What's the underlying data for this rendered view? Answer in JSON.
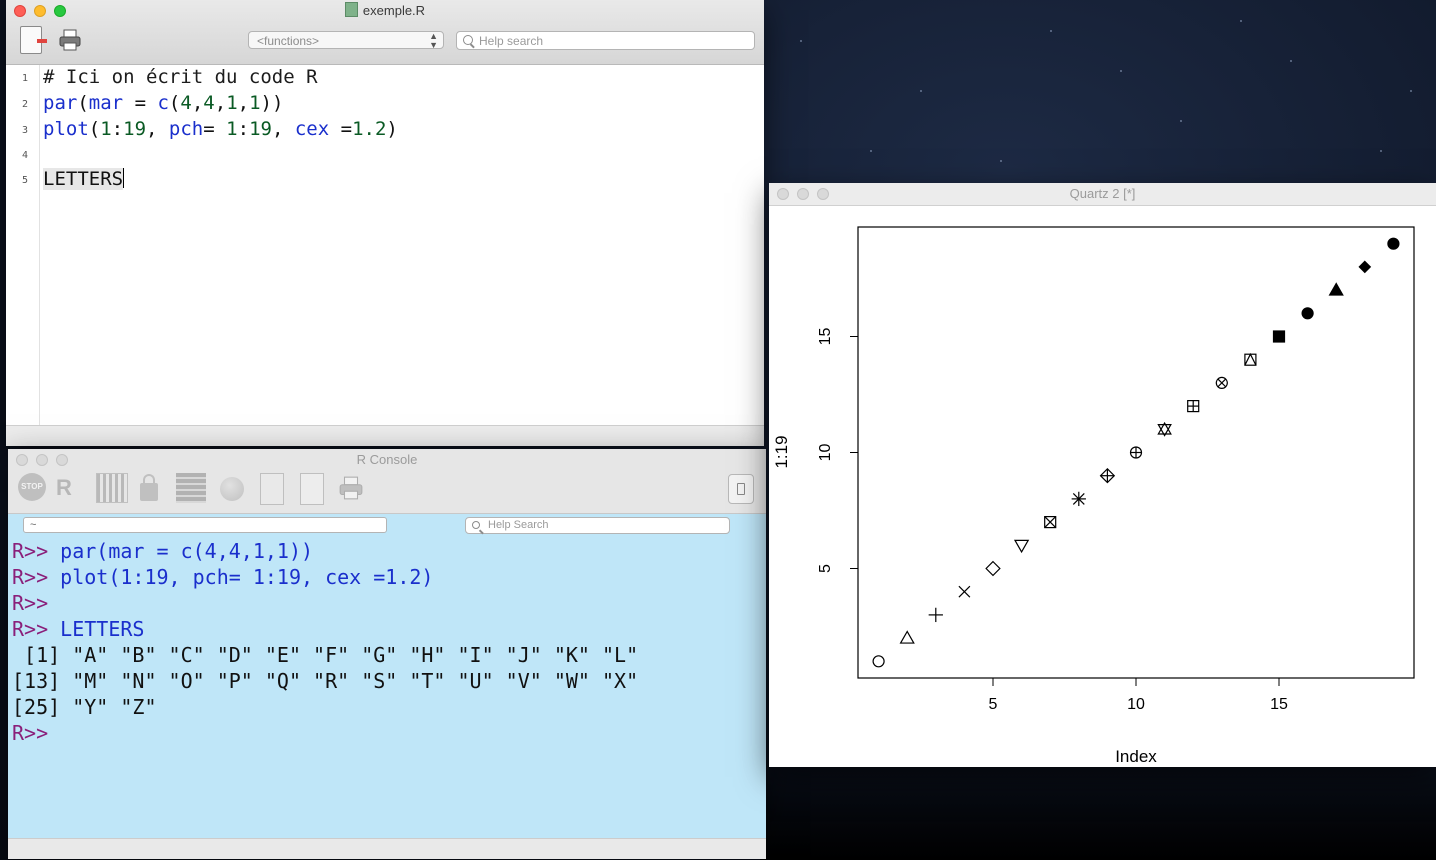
{
  "editor": {
    "title": "exemple.R",
    "functions_select": "<functions>",
    "help_search_placeholder": "Help search",
    "lines": [
      {
        "num": "1",
        "text": "# Ici on écrit du code R"
      },
      {
        "num": "2",
        "text": "par(mar = c(4,4,1,1))"
      },
      {
        "num": "3",
        "text": "plot(1:19, pch= 1:19, cex =1.2)"
      },
      {
        "num": "4",
        "text": ""
      },
      {
        "num": "5",
        "text": "LETTERS"
      }
    ]
  },
  "console": {
    "title": "R Console",
    "stop_label": "STOP",
    "r_label": "R",
    "dir_value": "~",
    "help_search_placeholder": "Help Search",
    "lines": [
      {
        "prompt": "R>>",
        "text": " par(mar = c(4,4,1,1))"
      },
      {
        "prompt": "R>>",
        "text": " plot(1:19, pch= 1:19, cex =1.2)"
      },
      {
        "prompt": "R>>",
        "text": ""
      },
      {
        "prompt": "R>>",
        "text": " LETTERS"
      },
      {
        "prompt": "",
        "text": " [1] \"A\" \"B\" \"C\" \"D\" \"E\" \"F\" \"G\" \"H\" \"I\" \"J\" \"K\" \"L\""
      },
      {
        "prompt": "",
        "text": "[13] \"M\" \"N\" \"O\" \"P\" \"Q\" \"R\" \"S\" \"T\" \"U\" \"V\" \"W\" \"X\""
      },
      {
        "prompt": "",
        "text": "[25] \"Y\" \"Z\""
      },
      {
        "prompt": "R>>",
        "text": ""
      }
    ],
    "colors": {
      "prompt": "#8a1f7a",
      "command": "#1a2fcc",
      "background": "#bfe6f8"
    }
  },
  "quartz": {
    "title": "Quartz 2 [*]"
  },
  "chart_data": {
    "type": "scatter",
    "x": [
      1,
      2,
      3,
      4,
      5,
      6,
      7,
      8,
      9,
      10,
      11,
      12,
      13,
      14,
      15,
      16,
      17,
      18,
      19
    ],
    "y": [
      1,
      2,
      3,
      4,
      5,
      6,
      7,
      8,
      9,
      10,
      11,
      12,
      13,
      14,
      15,
      16,
      17,
      18,
      19
    ],
    "pch": [
      1,
      2,
      3,
      4,
      5,
      6,
      7,
      8,
      9,
      10,
      11,
      12,
      13,
      14,
      15,
      16,
      17,
      18,
      19
    ],
    "xlabel": "Index",
    "ylabel": "1:19",
    "xticks": [
      5,
      10,
      15
    ],
    "yticks": [
      5,
      10,
      15
    ],
    "xlim": [
      0.28,
      19.72
    ],
    "ylim": [
      0.28,
      19.72
    ],
    "grid": false
  }
}
